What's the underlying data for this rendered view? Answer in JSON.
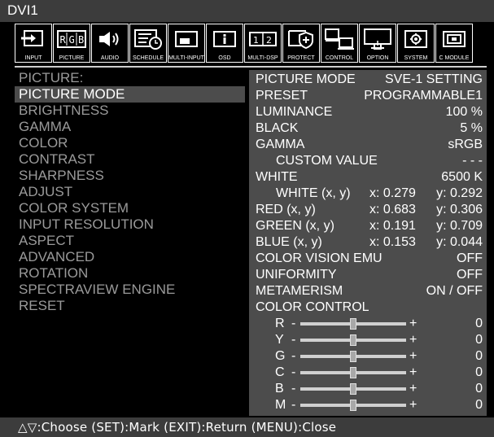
{
  "window": {
    "title": "DVI1"
  },
  "tabs": [
    {
      "label": "INPUT",
      "icon": "input-arrow-icon"
    },
    {
      "label": "PICTURE",
      "icon": "rgb-icon"
    },
    {
      "label": "AUDIO",
      "icon": "speaker-icon"
    },
    {
      "label": "SCHEDULE",
      "icon": "schedule-clock-icon"
    },
    {
      "label": "MULTI-INPUT",
      "icon": "pip-icon"
    },
    {
      "label": "OSD",
      "icon": "info-icon"
    },
    {
      "label": "MULTI-DSP",
      "icon": "multi-display-icon"
    },
    {
      "label": "PROTECT",
      "icon": "shield-icon"
    },
    {
      "label": "CONTROL",
      "icon": "computer-icon"
    },
    {
      "label": "OPTION",
      "icon": "monitor-upload-icon"
    },
    {
      "label": "SYSTEM",
      "icon": "gear-icon"
    },
    {
      "label": "C MODULE",
      "icon": "module-icon"
    }
  ],
  "menu": {
    "header": "PICTURE:",
    "items": [
      "PICTURE MODE",
      "BRIGHTNESS",
      "GAMMA",
      "COLOR",
      "CONTRAST",
      "SHARPNESS",
      "ADJUST",
      "COLOR SYSTEM",
      "INPUT RESOLUTION",
      "ASPECT",
      "ADVANCED",
      "ROTATION",
      "SPECTRAVIEW ENGINE",
      "RESET"
    ]
  },
  "settings": {
    "picture_mode": {
      "label": "PICTURE MODE",
      "value": "SVE-1 SETTING"
    },
    "preset": {
      "label": "PRESET",
      "value": "PROGRAMMABLE1"
    },
    "luminance": {
      "label": "LUMINANCE",
      "value": "100 %"
    },
    "black": {
      "label": "BLACK",
      "value": "5 %"
    },
    "gamma": {
      "label": "GAMMA",
      "value": "sRGB"
    },
    "custom_value": {
      "label": "CUSTOM VALUE",
      "value": "- - -"
    },
    "white": {
      "label": "WHITE",
      "value": "6500 K"
    },
    "white_xy": {
      "label": "WHITE (x, y)",
      "x": "x: 0.279",
      "y": "y: 0.292"
    },
    "red_xy": {
      "label": "RED (x, y)",
      "x": "x: 0.683",
      "y": "y: 0.306"
    },
    "green_xy": {
      "label": "GREEN (x, y)",
      "x": "x: 0.191",
      "y": "y: 0.709"
    },
    "blue_xy": {
      "label": "BLUE (x, y)",
      "x": "x: 0.153",
      "y": "y: 0.044"
    },
    "color_vision_emu": {
      "label": "COLOR VISION EMU",
      "value": "OFF"
    },
    "uniformity": {
      "label": "UNIFORMITY",
      "value": "OFF"
    },
    "metamerism": {
      "label": "METAMERISM",
      "value": "ON / OFF"
    },
    "color_control": {
      "label": "COLOR CONTROL"
    }
  },
  "sliders": [
    {
      "label": "R",
      "minus": "-",
      "plus": "+",
      "value": "0",
      "level": 0.5
    },
    {
      "label": "Y",
      "minus": "-",
      "plus": "+",
      "value": "0",
      "level": 0.5
    },
    {
      "label": "G",
      "minus": "-",
      "plus": "+",
      "value": "0",
      "level": 0.5
    },
    {
      "label": "C",
      "minus": "-",
      "plus": "+",
      "value": "0",
      "level": 0.5
    },
    {
      "label": "B",
      "minus": "-",
      "plus": "+",
      "value": "0",
      "level": 0.5
    },
    {
      "label": "M",
      "minus": "-",
      "plus": "+",
      "value": "0",
      "level": 0.5
    }
  ],
  "footer": {
    "hint": "△▽:Choose (SET):Mark (EXIT):Return (MENU):Close"
  },
  "colors": {
    "background": "#000000",
    "panel": "#4c4c4c",
    "title_bar": "#3c3c3c",
    "dim_text": "#9a9a9a",
    "text": "#ffffff"
  }
}
